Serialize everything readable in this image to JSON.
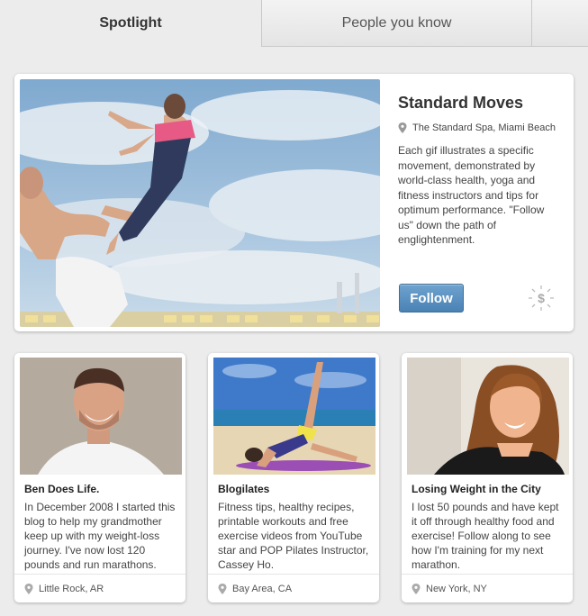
{
  "tabs": [
    {
      "label": "Spotlight",
      "active": true
    },
    {
      "label": "People you know",
      "active": false
    }
  ],
  "spotlight": {
    "title": "Standard Moves",
    "location": "The Standard Spa, Miami Beach",
    "description": "Each gif illustrates a specific movement, demonstrated by world-class health, yoga and fitness instructors and tips for optimum performance. \"Follow us\" down the path of englightenment.",
    "follow_label": "Follow",
    "icons": {
      "location": "map-pin-icon",
      "paid": "dollar-badge-icon"
    }
  },
  "cards": [
    {
      "title": "Ben Does Life.",
      "description": "In December 2008 I started this blog to help my grandmother keep up with my weight-loss journey. I've now lost 120 pounds and run marathons.",
      "location": "Little Rock, AR"
    },
    {
      "title": "Blogilates",
      "description": "Fitness tips, healthy recipes, printable workouts and free exercise videos from YouTube star and POP Pilates Instructor, Cassey Ho.",
      "location": "Bay Area, CA"
    },
    {
      "title": "Losing Weight in the City",
      "description": "I lost 50 pounds and have kept it off through healthy food and exercise! Follow along to see how I'm training for my next marathon.",
      "location": "New York, NY"
    }
  ],
  "colors": {
    "follow_button": "#5a91c2",
    "background": "#ececec",
    "card": "#ffffff"
  }
}
